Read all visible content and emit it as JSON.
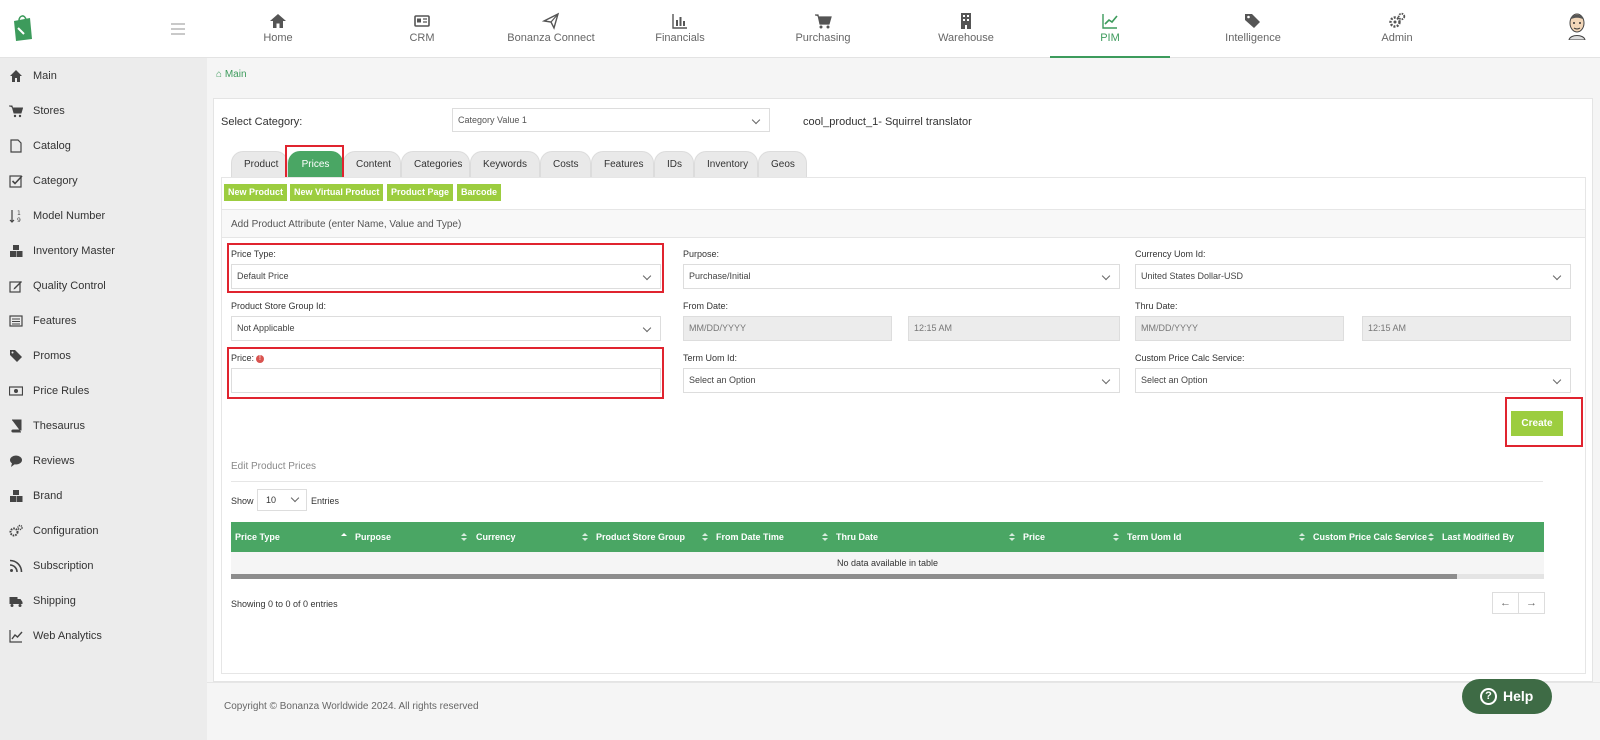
{
  "topnav": [
    {
      "label": "Home",
      "icon": "home-icon"
    },
    {
      "label": "CRM",
      "icon": "crm-icon"
    },
    {
      "label": "Bonanza Connect",
      "icon": "paper-plane-icon"
    },
    {
      "label": "Financials",
      "icon": "bar-chart-icon"
    },
    {
      "label": "Purchasing",
      "icon": "cart-icon"
    },
    {
      "label": "Warehouse",
      "icon": "building-icon"
    },
    {
      "label": "PIM",
      "icon": "line-chart-icon",
      "active": true
    },
    {
      "label": "Intelligence",
      "icon": "tags-icon"
    },
    {
      "label": "Admin",
      "icon": "gears-icon"
    }
  ],
  "sidebar": {
    "items": [
      {
        "label": "Main",
        "icon": "home-icon"
      },
      {
        "label": "Stores",
        "icon": "cart-icon"
      },
      {
        "label": "Catalog",
        "icon": "file-icon"
      },
      {
        "label": "Category",
        "icon": "check-square-icon"
      },
      {
        "label": "Model Number",
        "icon": "sort-numeric-icon"
      },
      {
        "label": "Inventory Master",
        "icon": "cubes-icon"
      },
      {
        "label": "Quality Control",
        "icon": "edit-icon"
      },
      {
        "label": "Features",
        "icon": "list-icon"
      },
      {
        "label": "Promos",
        "icon": "tags-icon"
      },
      {
        "label": "Price Rules",
        "icon": "money-icon"
      },
      {
        "label": "Thesaurus",
        "icon": "book-icon"
      },
      {
        "label": "Reviews",
        "icon": "comment-icon"
      },
      {
        "label": "Brand",
        "icon": "cubes-icon"
      },
      {
        "label": "Configuration",
        "icon": "gears-icon"
      },
      {
        "label": "Subscription",
        "icon": "rss-icon"
      },
      {
        "label": "Shipping",
        "icon": "truck-icon"
      },
      {
        "label": "Web Analytics",
        "icon": "line-chart-icon"
      }
    ]
  },
  "breadcrumb": {
    "label": "Main"
  },
  "category": {
    "label": "Select Category:",
    "value": "Category Value 1",
    "product_name": "cool_product_1- Squirrel translator"
  },
  "tabs": [
    {
      "label": "Product"
    },
    {
      "label": "Prices",
      "active": true
    },
    {
      "label": "Content"
    },
    {
      "label": "Categories"
    },
    {
      "label": "Keywords"
    },
    {
      "label": "Costs"
    },
    {
      "label": "Features"
    },
    {
      "label": "IDs"
    },
    {
      "label": "Inventory"
    },
    {
      "label": "Geos"
    }
  ],
  "actions": [
    "New Product",
    "New Virtual Product",
    "Product Page",
    "Barcode"
  ],
  "form": {
    "title": "Add Product Attribute (enter Name, Value and Type)",
    "price_type": {
      "label": "Price Type:",
      "value": "Default Price"
    },
    "purpose": {
      "label": "Purpose:",
      "value": "Purchase/Initial"
    },
    "currency": {
      "label": "Currency Uom Id:",
      "value": "United States Dollar-USD"
    },
    "store_group": {
      "label": "Product Store Group Id:",
      "value": "Not Applicable"
    },
    "from_date": {
      "label": "From Date:",
      "placeholder": "MM/DD/YYYY",
      "time": "12:15 AM"
    },
    "thru_date": {
      "label": "Thru Date:",
      "placeholder": "MM/DD/YYYY",
      "time": "12:15 AM"
    },
    "price": {
      "label": "Price:",
      "value": "",
      "required_icon": "!"
    },
    "term_uom": {
      "label": "Term Uom Id:",
      "value": "Select an Option"
    },
    "custom_calc": {
      "label": "Custom Price Calc Service:",
      "value": "Select an Option"
    },
    "create_label": "Create"
  },
  "table": {
    "title": "Edit Product Prices",
    "show_label": "Show",
    "page_size": "10",
    "entries_label": "Entries",
    "columns": [
      "Price Type",
      "Purpose",
      "Currency",
      "Product Store Group",
      "From Date Time",
      "Thru Date",
      "Price",
      "Term Uom Id",
      "Custom Price Calc Service",
      "Last Modified By"
    ],
    "empty_text": "No data available in table",
    "showing_text": "Showing 0 to 0 of 0 entries",
    "prev": "←",
    "next": "→"
  },
  "footer": {
    "copyright": "Copyright © Bonanza Worldwide 2024. All rights reserved",
    "help_label": "Help",
    "help_icon": "?"
  },
  "colors": {
    "brand_green": "#4aa664",
    "button_lime": "#9ccd3f",
    "highlight_red": "#e0242f",
    "help_dark_green": "#3e6b45"
  }
}
